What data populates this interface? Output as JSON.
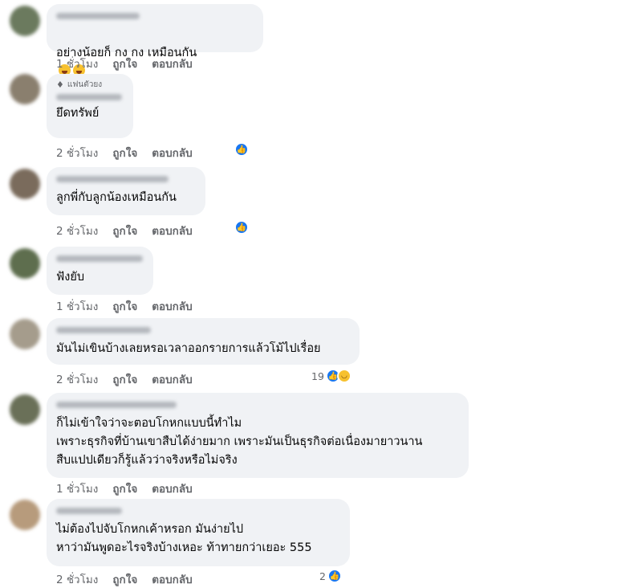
{
  "actions": {
    "like": "ถูกใจ",
    "reply": "ตอบกลับ"
  },
  "comments": [
    {
      "text": "อย่างน้อยก็ กง กง เหมือนกัน",
      "emoji": "rolling-on-floor-laughing-icon",
      "time": "1 ชั่วโมง",
      "reaction_count": "",
      "reactions": [],
      "avatar_color": "#6b7a5e"
    },
    {
      "badge": "แฟนตัวยง",
      "badge_icon": "diamond-icon",
      "text": "ยึดทรัพย์",
      "time": "2 ชั่วโมง",
      "reaction_count": "",
      "reactions": [
        "like"
      ],
      "avatar_color": "#8a7f6e"
    },
    {
      "text": "ลูกพี่กับลูกน้องเหมือนกัน",
      "time": "2 ชั่วโมง",
      "reaction_count": "",
      "reactions": [
        "like"
      ],
      "avatar_color": "#7a6b5c"
    },
    {
      "text": "ฟังยับ",
      "time": "1 ชั่วโมง",
      "reaction_count": "",
      "reactions": [],
      "avatar_color": "#5e6e4e"
    },
    {
      "text": "มันไม่เขินบ้างเลยหรอเวลาออกรายการแล้วโม้ไปเรื่อย",
      "time": "2 ชั่วโมง",
      "reaction_count": "19",
      "reactions": [
        "like",
        "haha"
      ],
      "avatar_color": "#a59c8c"
    },
    {
      "text": "ก็ไม่เข้าใจว่าจะตอบโกหกแบบนี้ทำไม\nเพราะธุรกิจที่บ้านเขาสืบได้ง่ายมาก เพราะมันเป็นธุรกิจต่อเนื่องมายาวนาน\nสืบแปปเดียวก็รู้แล้วว่าจริงหรือไม่จริง",
      "time": "1 ชั่วโมง",
      "reaction_count": "",
      "reactions": [],
      "avatar_color": "#6a7058"
    },
    {
      "text": "ไม่ต้องไปจับโกหกเค้าหรอก มันง่ายไป\nหาว่ามันพูดอะไรจริงบ้างเหอะ ท้าทายกว่าเยอะ 555",
      "time": "2 ชั่วโมง",
      "reaction_count": "2",
      "reactions": [
        "like"
      ],
      "avatar_color": "#b79b7c"
    }
  ],
  "colors": {
    "bubble": "#f0f2f5",
    "like": "#1877f2",
    "meta": "#65676b"
  }
}
